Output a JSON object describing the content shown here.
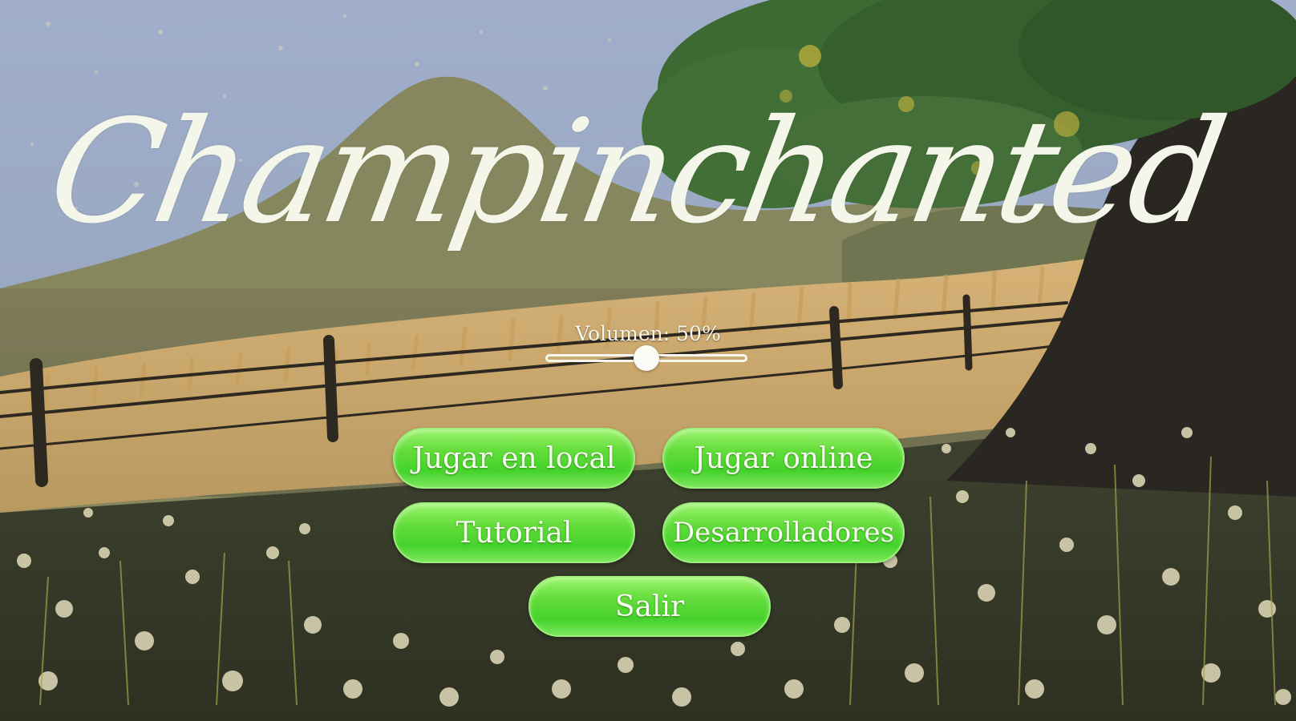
{
  "game": {
    "title": "Champinchanted"
  },
  "volume": {
    "label": "Volumen: 50%",
    "level": 0.5
  },
  "menu": {
    "play_local": "Jugar en local",
    "play_online": "Jugar online",
    "tutorial": "Tutorial",
    "developers": "Desarrolladores",
    "exit": "Salir"
  },
  "colors": {
    "button_green": "#4fd630",
    "title_text": "#f4f6ea",
    "sky": "#98a6bd",
    "tree_foliage": "#3f6b34"
  }
}
